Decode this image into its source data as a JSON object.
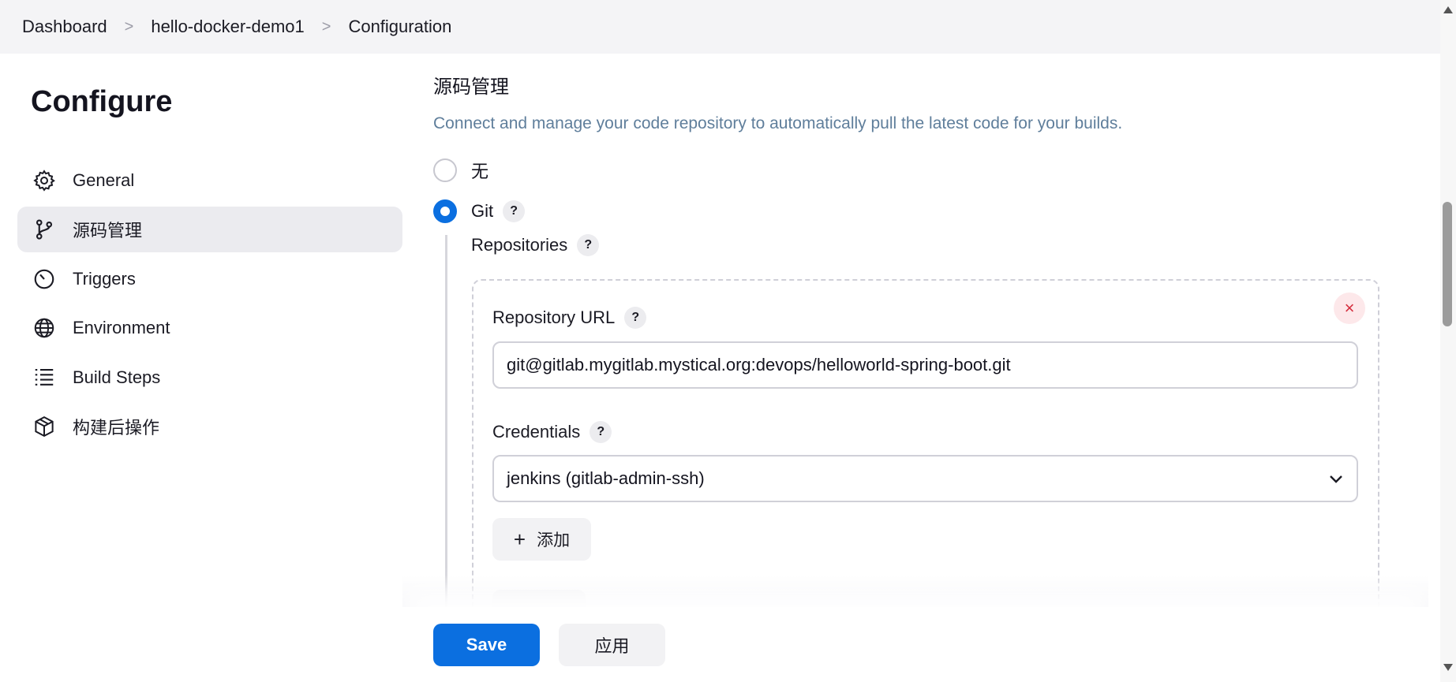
{
  "breadcrumb": {
    "items": [
      "Dashboard",
      "hello-docker-demo1",
      "Configuration"
    ],
    "separator": ">"
  },
  "sidebar": {
    "title": "Configure",
    "items": [
      {
        "label": "General",
        "icon": "gear-icon",
        "active": false
      },
      {
        "label": "源码管理",
        "icon": "branch-icon",
        "active": true
      },
      {
        "label": "Triggers",
        "icon": "clock-icon",
        "active": false
      },
      {
        "label": "Environment",
        "icon": "globe-icon",
        "active": false
      },
      {
        "label": "Build Steps",
        "icon": "list-icon",
        "active": false
      },
      {
        "label": "构建后操作",
        "icon": "package-icon",
        "active": false
      }
    ]
  },
  "scm": {
    "title": "源码管理",
    "description": "Connect and manage your code repository to automatically pull the latest code for your builds.",
    "options": [
      {
        "label": "无",
        "checked": false
      },
      {
        "label": "Git",
        "checked": true
      }
    ],
    "help_glyph": "?",
    "repositories_label": "Repositories",
    "repo_url_label": "Repository URL",
    "repo_url_value": "git@gitlab.mygitlab.mystical.org:devops/helloworld-spring-boot.git",
    "credentials_label": "Credentials",
    "credentials_value": "jenkins (gitlab-admin-ssh)",
    "add_label": "添加",
    "close_glyph": "×"
  },
  "footer": {
    "save_label": "Save",
    "apply_label": "应用"
  },
  "colors": {
    "accent": "#0b6fe0",
    "description": "#5f7e9b",
    "danger": "#d42c3c"
  }
}
